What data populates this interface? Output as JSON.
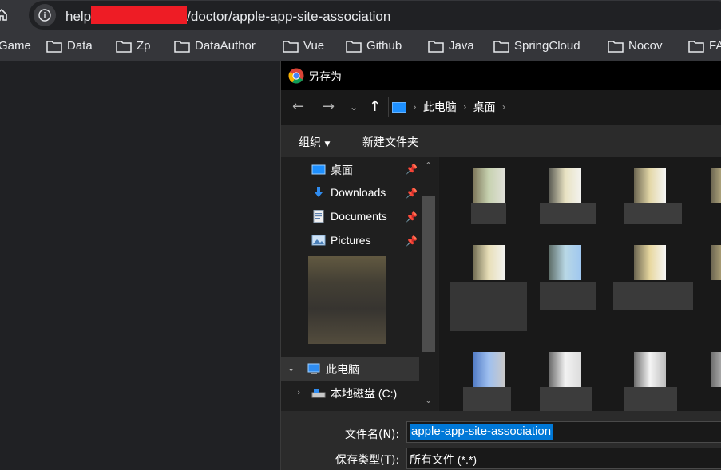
{
  "browser": {
    "url_prefix": "help",
    "url_suffix": "/doctor/apple-app-site-association",
    "bookmarks": [
      "Game",
      "Data",
      "Zp",
      "DataAuthor",
      "Vue",
      "Github",
      "Java",
      "SpringCloud",
      "Nocov",
      "FA"
    ]
  },
  "dialog": {
    "title": "另存为",
    "breadcrumb": [
      "此电脑",
      "桌面"
    ],
    "toolbar": {
      "organize": "组织",
      "new_folder": "新建文件夹"
    },
    "quick_access": [
      {
        "label": "桌面",
        "icon": "desktop-icon"
      },
      {
        "label": "Downloads",
        "icon": "download-icon"
      },
      {
        "label": "Documents",
        "icon": "document-icon"
      },
      {
        "label": "Pictures",
        "icon": "pictures-icon"
      }
    ],
    "tree": {
      "this_pc": "此电脑",
      "local_disk": "本地磁盘 (C:)"
    },
    "filename_label": "文件名(N):",
    "filename_value": "apple-app-site-association",
    "filetype_label": "保存类型(T):",
    "filetype_value": "所有文件 (*.*)"
  },
  "colors": {
    "selection": "#0078d7",
    "redaction": "#ee1c25",
    "folder_accent": "#1e90ff"
  }
}
